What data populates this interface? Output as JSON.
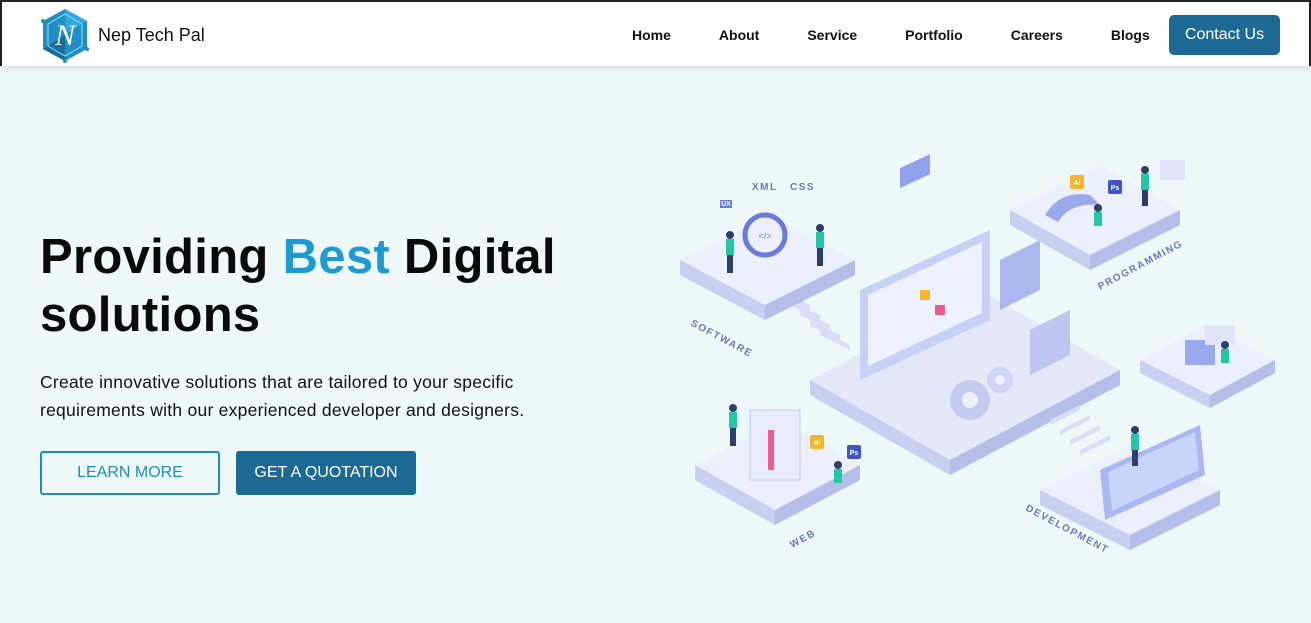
{
  "brand": {
    "name": "Nep Tech Pal",
    "logo_icon": "hexagon-n-logo-icon",
    "colors": {
      "primary": "#1c6a93",
      "accent": "#1d9ad2",
      "background": "#eef8f9"
    }
  },
  "nav": {
    "items": [
      {
        "label": "Home"
      },
      {
        "label": "About"
      },
      {
        "label": "Service"
      },
      {
        "label": "Portfolio"
      },
      {
        "label": "Careers"
      },
      {
        "label": "Blogs"
      }
    ],
    "contact_label": "Contact Us"
  },
  "hero": {
    "title_prefix": "Providing ",
    "title_accent": "Best",
    "title_suffix": " Digital solutions",
    "description": "Create innovative solutions that are tailored to your specific requirements with our experienced developer and designers.",
    "learn_more_label": "LEARN MORE",
    "quotation_label": "GET A QUOTATION"
  },
  "illustration": {
    "labels": {
      "software": "SOFTWARE",
      "programming": "PROGRAMMING",
      "web": "WEB",
      "development": "DEVELOPMENT"
    },
    "tags": {
      "ux": "UX",
      "xml": "XML",
      "css": "CSS",
      "ai": "Ai",
      "ps": "Ps",
      "code": "</>"
    }
  }
}
